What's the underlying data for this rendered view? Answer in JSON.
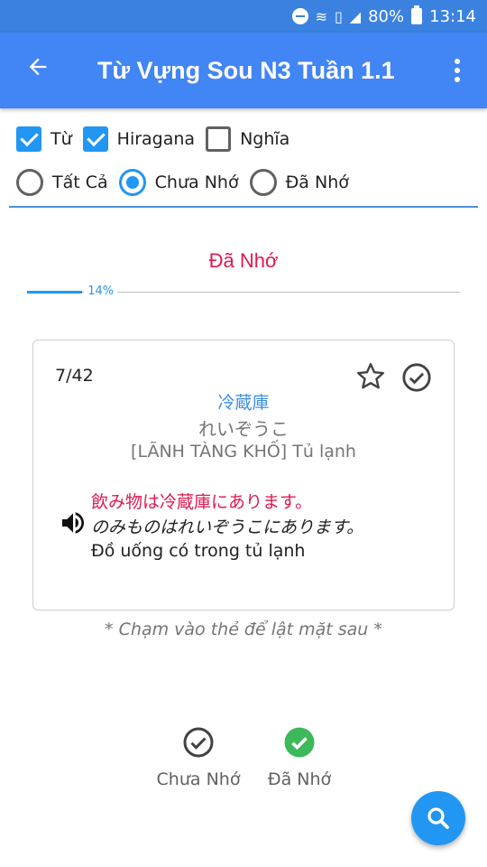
{
  "status_bar": {
    "battery": "80%",
    "time": "13:14"
  },
  "app_bar": {
    "title": "Từ Vựng Sou N3 Tuần 1.1"
  },
  "filters": {
    "checkboxes": [
      {
        "label": "Từ",
        "checked": true
      },
      {
        "label": "Hiragana",
        "checked": true
      },
      {
        "label": "Nghĩa",
        "checked": false
      }
    ],
    "radios": [
      {
        "label": "Tất Cả",
        "selected": false
      },
      {
        "label": "Chưa Nhớ",
        "selected": true
      },
      {
        "label": "Đã Nhớ",
        "selected": false
      }
    ]
  },
  "status_title": "Đã Nhớ",
  "progress": {
    "value": 0.14,
    "label": "14%"
  },
  "card": {
    "counter": "7/42",
    "kanji": "冷蔵庫",
    "hiragana": "れいぞうこ",
    "meaning": "[LÃNH TÀNG KHỐ] Tủ lạnh",
    "example_jp": "飲み物は冷蔵庫にあります。",
    "example_kana": "のみものはれいぞうこにあります。",
    "example_vi": "Đồ uống có trong tủ lạnh"
  },
  "hint": "* Chạm vào thẻ để lật mặt sau *",
  "bottom": {
    "not_remembered_label": "Chưa Nhớ",
    "remembered_label": "Đã Nhớ"
  },
  "colors": {
    "primary": "#4285f4",
    "accent": "#2196f3",
    "highlight": "#e0194f",
    "success": "#3cb95a"
  }
}
